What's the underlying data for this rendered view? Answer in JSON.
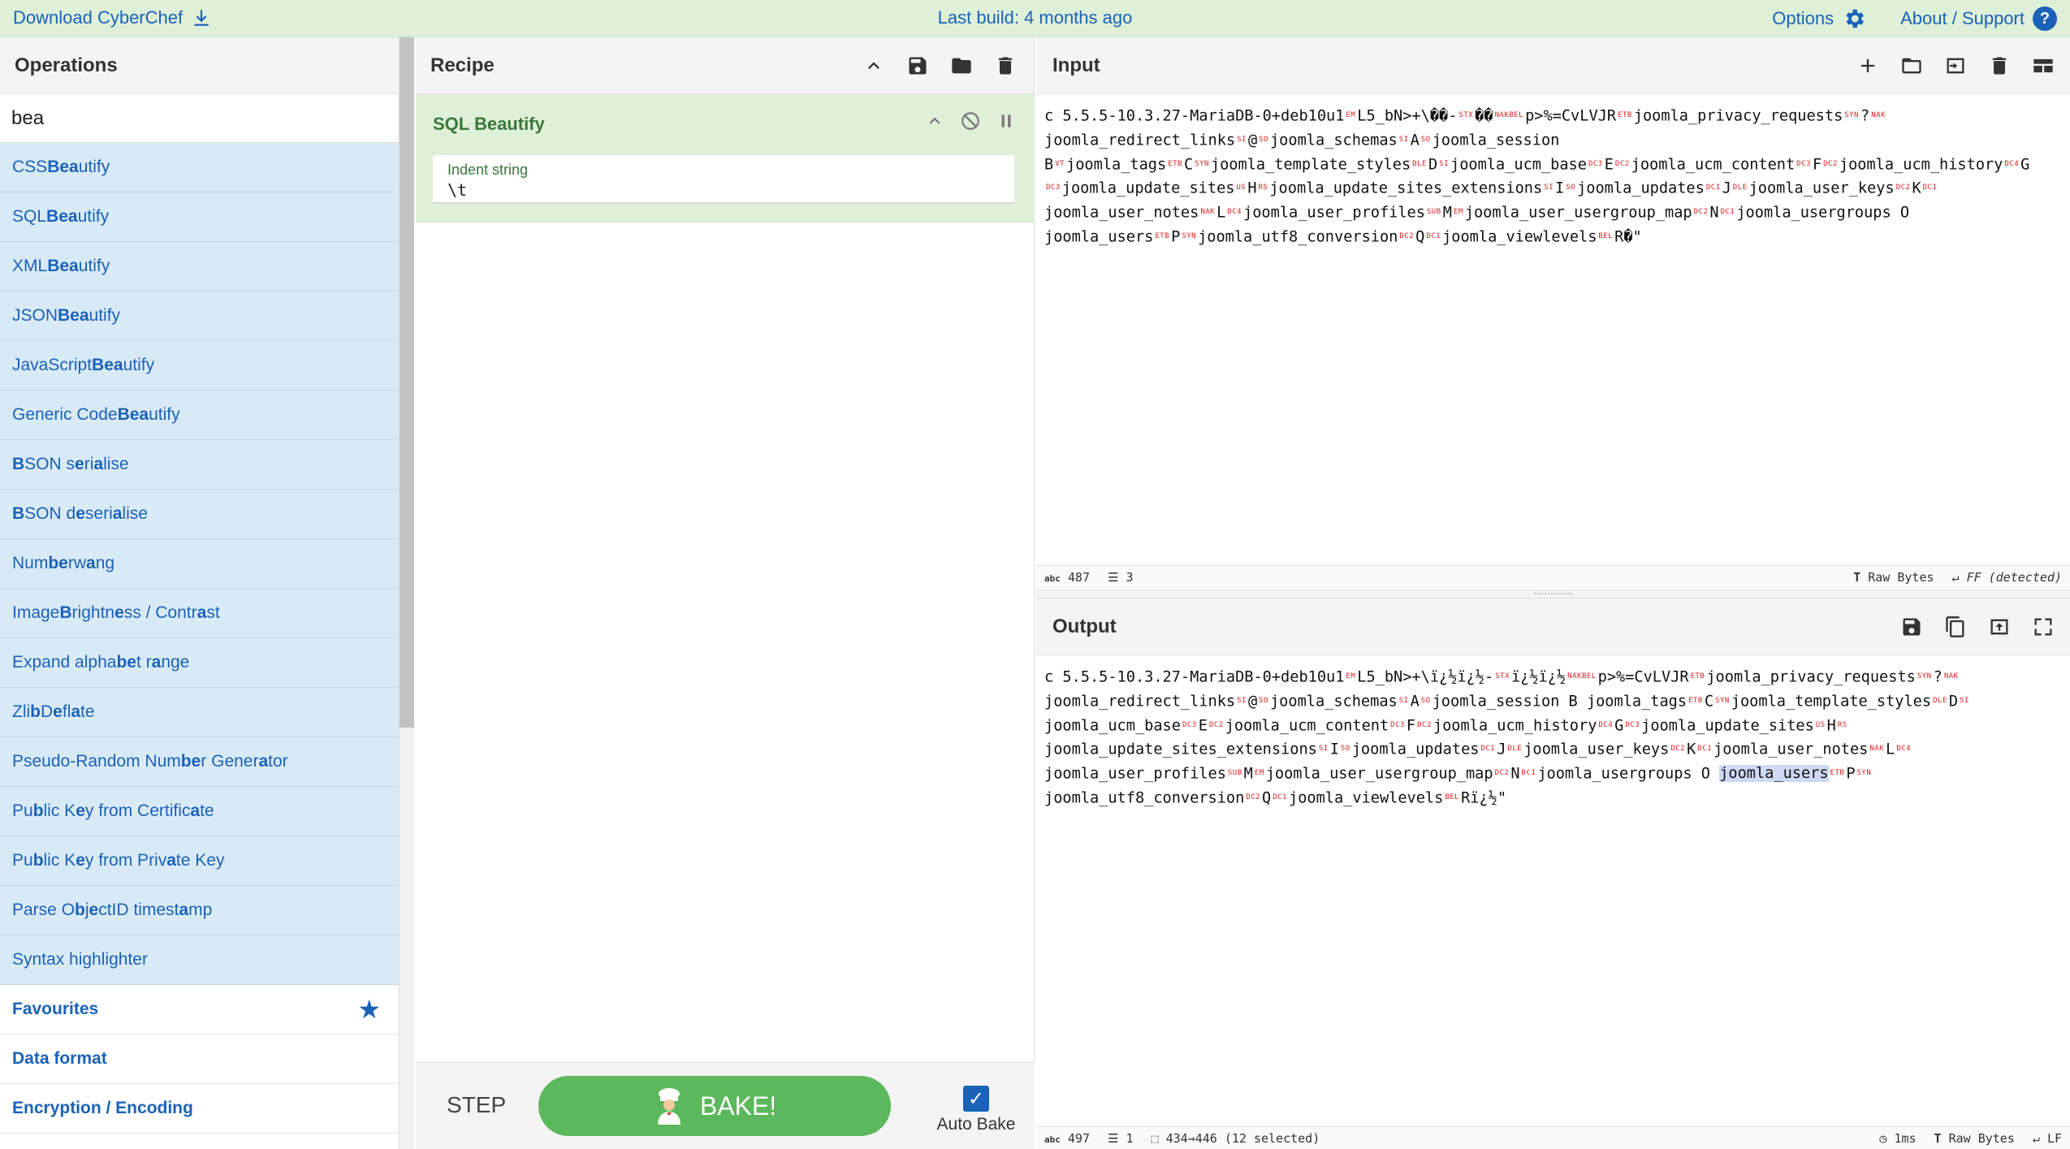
{
  "banner": {
    "download_label": "Download CyberChef",
    "last_build": "Last build: 4 months ago",
    "options_label": "Options",
    "about_label": "About / Support"
  },
  "operations": {
    "title": "Operations",
    "search_value": "bea",
    "items": [
      {
        "pre": "CSS ",
        "hl": "Bea",
        "post": "utify"
      },
      {
        "pre": "SQL ",
        "hl": "Bea",
        "post": "utify"
      },
      {
        "pre": "XML ",
        "hl": "Bea",
        "post": "utify"
      },
      {
        "pre": "JSON ",
        "hl": "Bea",
        "post": "utify"
      },
      {
        "pre": "JavaScript ",
        "hl": "Bea",
        "post": "utify"
      },
      {
        "pre": "Generic Code ",
        "hl": "Bea",
        "post": "utify"
      },
      {
        "html": "<b>B</b>SON s<b>e</b>ri<b>a</b>lise"
      },
      {
        "html": "<b>B</b>SON d<b>e</b>seri<b>a</b>lise"
      },
      {
        "html": "Num<b>be</b>rw<b>a</b>ng"
      },
      {
        "html": "Image <b>B</b>rightn<b>e</b>ss / Contr<b>a</b>st"
      },
      {
        "html": "Expand alpha<b>be</b>t r<b>a</b>nge"
      },
      {
        "html": "Zli<b>b</b> D<b>e</b>fl<b>a</b>te"
      },
      {
        "html": "Pseudo-Random Num<b>be</b>r Gener<b>a</b>tor"
      },
      {
        "html": "Pu<b>b</b>lic K<b>e</b>y from Certific<b>a</b>te"
      },
      {
        "html": "Pu<b>b</b>lic K<b>e</b>y from Priv<b>a</b>te Key"
      },
      {
        "html": "Parse O<b>b</b>j<b>e</b>ctID timest<b>a</b>mp"
      },
      {
        "html": "Syntax highlighter"
      }
    ],
    "categories": [
      "Favourites",
      "Data format",
      "Encryption / Encoding"
    ]
  },
  "recipe": {
    "title": "Recipe",
    "operation_name": "SQL Beautify",
    "indent_label": "Indent string",
    "indent_value": "\\t",
    "step_label": "STEP",
    "bake_label": "BAKE!",
    "autobake_label": "Auto Bake",
    "autobake_checked": true
  },
  "input": {
    "title": "Input",
    "status_chars": "487",
    "status_lines": "3",
    "status_raw": "Raw Bytes",
    "status_eol": "FF (detected)"
  },
  "output": {
    "title": "Output",
    "status_chars": "497",
    "status_lines": "1",
    "status_sel": "434→446 (12 selected)",
    "status_time": "1ms",
    "status_raw": "Raw Bytes",
    "status_eol": "LF"
  },
  "colors": {
    "accent": "#1a62b8",
    "banner_bg": "#dff0d8",
    "bake": "#5cb85c",
    "op_bg": "#d9eaf7",
    "recipe_text": "#3c763d"
  }
}
